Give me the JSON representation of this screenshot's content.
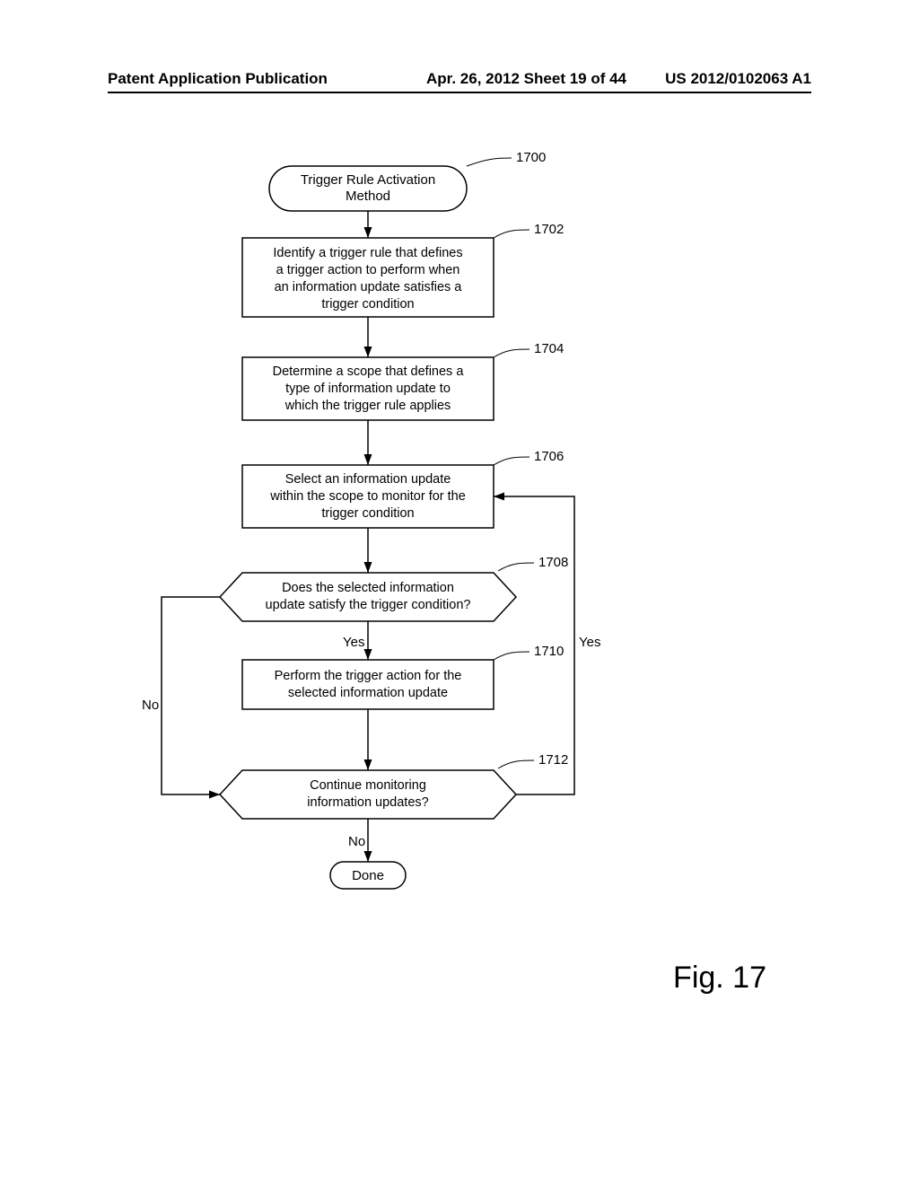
{
  "header": {
    "left": "Patent Application Publication",
    "date": "Apr. 26, 2012  Sheet 19 of 44",
    "right": "US 2012/0102063 A1"
  },
  "figure_label": "Fig. 17",
  "nodes": {
    "n1700": {
      "ref": "1700",
      "text": "Trigger Rule Activation\nMethod"
    },
    "n1702": {
      "ref": "1702",
      "text": "Identify a trigger rule that defines\na trigger action to perform when\nan information update satisfies a\ntrigger condition"
    },
    "n1704": {
      "ref": "1704",
      "text": "Determine a scope that defines a\ntype of information update to\nwhich the trigger rule applies"
    },
    "n1706": {
      "ref": "1706",
      "text": "Select an information update\nwithin the scope to monitor for the\ntrigger condition"
    },
    "n1708": {
      "ref": "1708",
      "text": "Does the selected information\nupdate satisfy the trigger condition?"
    },
    "n1710": {
      "ref": "1710",
      "text": "Perform the trigger action for the\nselected information update"
    },
    "n1712": {
      "ref": "1712",
      "text": "Continue monitoring\ninformation updates?"
    },
    "done": {
      "text": "Done"
    }
  },
  "labels": {
    "yes": "Yes",
    "no": "No"
  },
  "chart_data": {
    "type": "flowchart",
    "title": "Trigger Rule Activation Method",
    "nodes": [
      {
        "id": "1700",
        "type": "terminator",
        "text": "Trigger Rule Activation Method"
      },
      {
        "id": "1702",
        "type": "process",
        "text": "Identify a trigger rule that defines a trigger action to perform when an information update satisfies a trigger condition"
      },
      {
        "id": "1704",
        "type": "process",
        "text": "Determine a scope that defines a type of information update to which the trigger rule applies"
      },
      {
        "id": "1706",
        "type": "process",
        "text": "Select an information update within the scope to monitor for the trigger condition"
      },
      {
        "id": "1708",
        "type": "decision",
        "text": "Does the selected information update satisfy the trigger condition?"
      },
      {
        "id": "1710",
        "type": "process",
        "text": "Perform the trigger action for the selected information update"
      },
      {
        "id": "1712",
        "type": "decision",
        "text": "Continue monitoring information updates?"
      },
      {
        "id": "done",
        "type": "terminator",
        "text": "Done"
      }
    ],
    "edges": [
      {
        "from": "1700",
        "to": "1702"
      },
      {
        "from": "1702",
        "to": "1704"
      },
      {
        "from": "1704",
        "to": "1706"
      },
      {
        "from": "1706",
        "to": "1708"
      },
      {
        "from": "1708",
        "to": "1710",
        "label": "Yes"
      },
      {
        "from": "1708",
        "to": "1712",
        "label": "No"
      },
      {
        "from": "1710",
        "to": "1712"
      },
      {
        "from": "1712",
        "to": "1706",
        "label": "Yes"
      },
      {
        "from": "1712",
        "to": "done",
        "label": "No"
      }
    ]
  }
}
